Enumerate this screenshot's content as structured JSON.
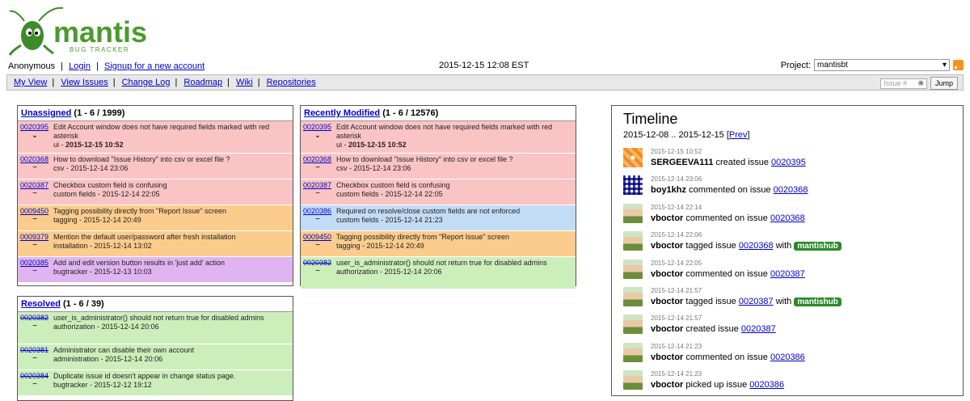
{
  "header": {
    "logo_text": "mantis",
    "logo_subtext": "BUG TRACKER",
    "user": "Anonymous",
    "login": "Login",
    "signup": "Signup for a new account",
    "datetime": "2015-12-15 12:08 EST",
    "project_label": "Project:",
    "project_value": "mantisbt",
    "issue_placeholder": "Issue #",
    "jump_label": "Jump"
  },
  "menu": [
    "My View",
    "View Issues",
    "Change Log",
    "Roadmap",
    "Wiki",
    "Repositories"
  ],
  "unassigned": {
    "title": "Unassigned",
    "count": "(1 - 6 / 1999)",
    "rows": [
      {
        "id": "0020395",
        "text": "Edit Account window does not have required fields marked with red asterisk",
        "cat": "ui",
        "date": "2015-12-15 10:52",
        "bold": true,
        "color": "pink",
        "ctrl": "⌄",
        "strike": false
      },
      {
        "id": "0020368",
        "text": "How to download \"Issue History\" into csv or excel file ?",
        "cat": "csv",
        "date": "2015-12-14 23:06",
        "bold": false,
        "color": "pink",
        "ctrl": "−",
        "strike": false
      },
      {
        "id": "0020387",
        "text": "Checkbox custom field is confusing",
        "cat": "custom fields",
        "date": "2015-12-14 22:05",
        "bold": false,
        "color": "pink",
        "ctrl": "−",
        "strike": false
      },
      {
        "id": "0009450",
        "text": "Tagging possibility directly from \"Report Issue\" screen",
        "cat": "tagging",
        "date": "2015-12-14 20:49",
        "bold": false,
        "color": "orange",
        "ctrl": "−",
        "strike": false
      },
      {
        "id": "0009379",
        "text": "Mention the default user/password after fresh installation",
        "cat": "installation",
        "date": "2015-12-14 13:02",
        "bold": false,
        "color": "orange",
        "ctrl": "−",
        "strike": false
      },
      {
        "id": "0020385",
        "text": "Add and edit version button results in 'just add' action",
        "cat": "bugtracker",
        "date": "2015-12-13 10:03",
        "bold": false,
        "color": "purple",
        "ctrl": "−",
        "strike": false
      }
    ]
  },
  "recent": {
    "title": "Recently Modified",
    "count": "(1 - 6 / 12576)",
    "rows": [
      {
        "id": "0020395",
        "text": "Edit Account window does not have required fields marked with red asterisk",
        "cat": "ui",
        "date": "2015-12-15 10:52",
        "bold": true,
        "color": "pink",
        "ctrl": "⌄",
        "strike": false
      },
      {
        "id": "0020368",
        "text": "How to download \"Issue History\" into csv or excel file ?",
        "cat": "csv",
        "date": "2015-12-14 23:06",
        "bold": false,
        "color": "pink",
        "ctrl": "−",
        "strike": false
      },
      {
        "id": "0020387",
        "text": "Checkbox custom field is confusing",
        "cat": "custom fields",
        "date": "2015-12-14 22:05",
        "bold": false,
        "color": "pink",
        "ctrl": "−",
        "strike": false
      },
      {
        "id": "0020386",
        "text": "Required on resolve/close custom fields are not enforced",
        "cat": "custom fields",
        "date": "2015-12-14 21:23",
        "bold": false,
        "color": "blue",
        "ctrl": "−",
        "strike": false
      },
      {
        "id": "0009450",
        "text": "Tagging possibility directly from \"Report Issue\" screen",
        "cat": "tagging",
        "date": "2015-12-14 20:49",
        "bold": false,
        "color": "orange",
        "ctrl": "−",
        "strike": false
      },
      {
        "id": "0020382",
        "text": "user_is_administrator() should not return true for disabled admins",
        "cat": "authorization",
        "date": "2015-12-14 20:06",
        "bold": false,
        "color": "green",
        "ctrl": "−",
        "strike": true
      }
    ]
  },
  "resolved": {
    "title": "Resolved",
    "count": "(1 - 6 / 39)",
    "rows": [
      {
        "id": "0020382",
        "text": "user_is_administrator() should not return true for disabled admins",
        "cat": "authorization",
        "date": "2015-12-14 20:06",
        "bold": false,
        "color": "green",
        "ctrl": "−",
        "strike": true
      },
      {
        "id": "0020381",
        "text": "Administrator can disable their own account",
        "cat": "administration",
        "date": "2015-12-14 20:06",
        "bold": false,
        "color": "green",
        "ctrl": "−",
        "strike": true
      },
      {
        "id": "0020384",
        "text": "Duplicate issue id doesn't appear in change status page.",
        "cat": "bugtracker",
        "date": "2015-12-12 19:12",
        "bold": false,
        "color": "green",
        "ctrl": "−",
        "strike": true
      }
    ]
  },
  "timeline": {
    "title": "Timeline",
    "range": "2015-12-08 .. 2015-12-15",
    "prev": "Prev",
    "entries": [
      {
        "time": "2015-12-15 10:52",
        "user": "SERGEEVA111",
        "action": "created issue",
        "issue": "0020395",
        "tag": "",
        "avatar": "orange"
      },
      {
        "time": "2015-12-14 23:06",
        "user": "boy1khz",
        "action": "commented on issue",
        "issue": "0020368",
        "tag": "",
        "avatar": "blue"
      },
      {
        "time": "2015-12-14 22:14",
        "user": "vboctor",
        "action": "commented on issue",
        "issue": "0020368",
        "tag": "",
        "avatar": "photo"
      },
      {
        "time": "2015-12-14 22:06",
        "user": "vboctor",
        "action": "tagged issue",
        "issue": "0020368",
        "tag": "mantishub",
        "avatar": "photo"
      },
      {
        "time": "2015-12-14 22:05",
        "user": "vboctor",
        "action": "commented on issue",
        "issue": "0020387",
        "tag": "",
        "avatar": "photo"
      },
      {
        "time": "2015-12-14 21:57",
        "user": "vboctor",
        "action": "tagged issue",
        "issue": "0020387",
        "tag": "mantishub",
        "avatar": "photo"
      },
      {
        "time": "2015-12-14 21:57",
        "user": "vboctor",
        "action": "created issue",
        "issue": "0020387",
        "tag": "",
        "avatar": "photo"
      },
      {
        "time": "2015-12-14 21:23",
        "user": "vboctor",
        "action": "commented on issue",
        "issue": "0020386",
        "tag": "",
        "avatar": "photo"
      },
      {
        "time": "2015-12-14 21:23",
        "user": "vboctor",
        "action": "picked up issue",
        "issue": "0020386",
        "tag": "",
        "avatar": "photo"
      }
    ]
  }
}
